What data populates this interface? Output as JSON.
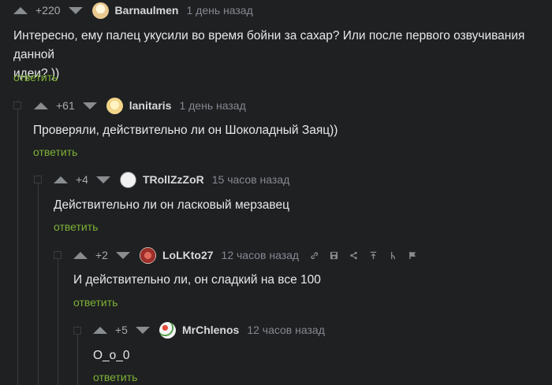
{
  "comments": [
    {
      "rating": "+220",
      "author": "Barnaulmen",
      "time": "1 день назад",
      "text_line1": "Интересно, ему палец укусили во время бойни за сахар? Или после первого озвучивания данной",
      "text_line2": "идеи? ))",
      "reply": "ответить",
      "avatar_color": "#e9c98f"
    },
    {
      "rating": "+61",
      "author": "lanitaris",
      "time": "1 день назад",
      "text": "Проверяли, действительно ли он Шоколадный Заяц))",
      "reply": "ответить",
      "avatar_color": "#f2d58a"
    },
    {
      "rating": "+4",
      "author": "TRollZzZoR",
      "time": "15 часов назад",
      "text": "Действительно ли он ласковый мерзавец",
      "reply": "ответить",
      "avatar_color": "#f2f2f2"
    },
    {
      "rating": "+2",
      "author": "LoLKto27",
      "time": "12 часов назад",
      "text": "И действительно ли, он сладкий на все 100",
      "reply": "ответить",
      "avatar_color": "#b8403a",
      "tools": [
        "link-icon",
        "save-icon",
        "share-icon",
        "jump-to-parent-icon",
        "hide-branch-icon",
        "report-flag-icon"
      ]
    },
    {
      "rating": "+5",
      "author": "MrChlenos",
      "time": "12 часов назад",
      "text": "О_о_0",
      "reply": "ответить",
      "avatar_color": "#f4f4f4"
    }
  ],
  "colors": {
    "background": "#1e2022",
    "reply_link": "#7fb135",
    "branch_line": "#3a3d40"
  }
}
